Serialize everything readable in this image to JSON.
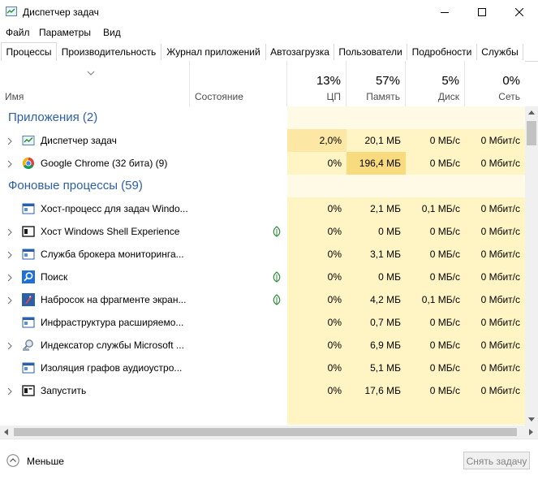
{
  "window": {
    "title": "Диспетчер задач"
  },
  "menu": [
    "Файл",
    "Параметры",
    "Вид"
  ],
  "tabs": [
    "Процессы",
    "Производительность",
    "Журнал приложений",
    "Автозагрузка",
    "Пользователи",
    "Подробности",
    "Службы"
  ],
  "columns": {
    "name": "Имя",
    "status": "Состояние",
    "cpu": {
      "pct": "13%",
      "label": "ЦП"
    },
    "mem": {
      "pct": "57%",
      "label": "Память"
    },
    "disk": {
      "pct": "5%",
      "label": "Диск"
    },
    "net": {
      "pct": "0%",
      "label": "Сеть"
    }
  },
  "groups": {
    "apps": "Приложения (2)",
    "background": "Фоновые процессы (59)"
  },
  "apps": [
    {
      "name": "Диспетчер задач",
      "cpu": "2,0%",
      "mem": "20,1 МБ",
      "disk": "0 МБ/с",
      "net": "0 Мбит/с",
      "icon": "task-manager-icon"
    },
    {
      "name": "Google Chrome (32 бита) (9)",
      "cpu": "0%",
      "mem": "196,4 МБ",
      "disk": "0 МБ/с",
      "net": "0 Мбит/с",
      "icon": "chrome-icon"
    }
  ],
  "background": [
    {
      "name": "Хост-процесс для задач Windo...",
      "cpu": "0%",
      "mem": "2,1 МБ",
      "disk": "0,1 МБ/с",
      "net": "0 Мбит/с",
      "icon": "window-icon"
    },
    {
      "name": "Хост Windows Shell Experience",
      "cpu": "0%",
      "mem": "0 МБ",
      "disk": "0 МБ/с",
      "net": "0 Мбит/с",
      "icon": "shell-icon"
    },
    {
      "name": "Служба брокера мониторинга...",
      "cpu": "0%",
      "mem": "3,1 МБ",
      "disk": "0 МБ/с",
      "net": "0 Мбит/с",
      "icon": "window-icon"
    },
    {
      "name": "Поиск",
      "cpu": "0%",
      "mem": "0 МБ",
      "disk": "0 МБ/с",
      "net": "0 Мбит/с",
      "icon": "search-icon"
    },
    {
      "name": "Набросок на фрагменте экран...",
      "cpu": "0%",
      "mem": "4,2 МБ",
      "disk": "0,1 МБ/с",
      "net": "0 Мбит/с",
      "icon": "snip-icon"
    },
    {
      "name": "Инфраструктура расширяемо...",
      "cpu": "0%",
      "mem": "0,7 МБ",
      "disk": "0 МБ/с",
      "net": "0 Мбит/с",
      "icon": "window-icon"
    },
    {
      "name": "Индексатор службы Microsoft ...",
      "cpu": "0%",
      "mem": "6,9 МБ",
      "disk": "0 МБ/с",
      "net": "0 Мбит/с",
      "icon": "indexer-icon"
    },
    {
      "name": "Изоляция графов аудиоустро...",
      "cpu": "0%",
      "mem": "5,1 МБ",
      "disk": "0 МБ/с",
      "net": "0 Мбит/с",
      "icon": "window-icon"
    },
    {
      "name": "Запустить",
      "cpu": "0%",
      "mem": "17,6 МБ",
      "disk": "0 МБ/с",
      "net": "0 Мбит/с",
      "icon": "run-icon"
    }
  ],
  "footer": {
    "fewer": "Меньше",
    "end_task": "Снять задачу"
  }
}
